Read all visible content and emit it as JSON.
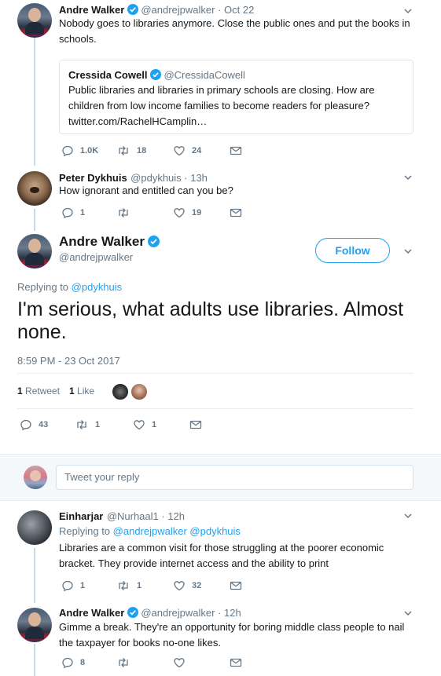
{
  "colors": {
    "accent": "#1da1f2",
    "muted": "#657786",
    "text": "#14171a",
    "divider": "#e6ecf0",
    "thread": "#c4dbe9"
  },
  "tweet1": {
    "name": "Andre Walker",
    "handle": "@andrejpwalker · Oct 22",
    "text": "Nobody goes to libraries anymore. Close the public ones and put the books in schools.",
    "quote": {
      "name": "Cressida Cowell",
      "handle": "@CressidaCowell",
      "text": "Public libraries and libraries in primary schools are closing. How are children from low income families to become readers for pleasure? twitter.com/RachelHCamplin…"
    },
    "replies": "1.0K",
    "retweets": "18",
    "likes": "24"
  },
  "tweet2": {
    "name": "Peter Dykhuis",
    "handle": "@pdykhuis · 13h",
    "text": "How ignorant and entitled can you be?",
    "replies": "1",
    "retweets": "",
    "likes": "19"
  },
  "main": {
    "name": "Andre Walker",
    "handle": "@andrejpwalker",
    "follow_label": "Follow",
    "replying_prefix": "Replying to",
    "replying_handle": "@pdykhuis",
    "text": "I'm serious, what adults use libraries. Almost none.",
    "timestamp": "8:59 PM - 23 Oct 2017",
    "retweet_count": "1",
    "retweet_label": "Retweet",
    "like_count": "1",
    "like_label": "Like",
    "replies": "43",
    "retweets": "1",
    "likes": "1"
  },
  "reply_box": {
    "placeholder": "Tweet your reply"
  },
  "tweet3": {
    "name": "Einharjar",
    "handle": "@Nurhaal1 · 12h",
    "replying_prefix": "Replying to",
    "replying_handles": "@andrejpwalker @pdykhuis",
    "text": "Libraries are a common visit for those struggling at the poorer economic bracket. They provide internet access and the ability to print",
    "replies": "1",
    "retweets": "1",
    "likes": "32"
  },
  "tweet4": {
    "name": "Andre Walker",
    "handle": "@andrejpwalker · 12h",
    "text": "Gimme a break. They're an opportunity for boring middle class people to nail the taxpayer for books no-one likes.",
    "replies": "8",
    "retweets": "",
    "likes": ""
  }
}
